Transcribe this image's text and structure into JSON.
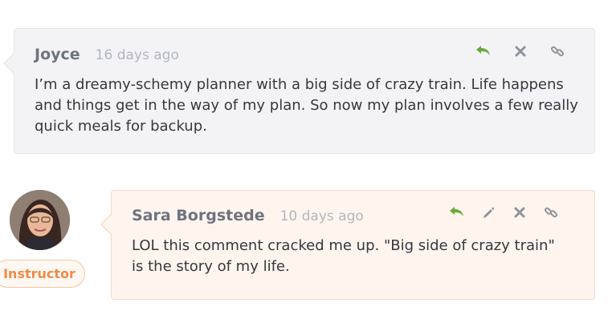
{
  "comments": [
    {
      "author": "Joyce",
      "timestamp": "16 days ago",
      "body": "I’m a dreamy-schemy planner with a big side of crazy train. Life happens and things get in the way of my plan. So now my plan involves a few really quick meals for backup.",
      "actions": [
        "reply-icon",
        "close-icon",
        "link-icon"
      ],
      "background": "#f3f3f5"
    },
    {
      "author": "Sara Borgstede",
      "timestamp": "10 days ago",
      "body": "LOL this comment cracked me up. \"Big side of crazy train\" is the story of my life.",
      "role": "Instructor",
      "actions": [
        "reply-icon",
        "edit-icon",
        "close-icon",
        "link-icon"
      ],
      "background": "#fff5ee"
    }
  ],
  "colors": {
    "reply": "#6aaa3a",
    "icon": "#8e929b",
    "badge_text": "#f08a46",
    "author": "#6e7380"
  }
}
